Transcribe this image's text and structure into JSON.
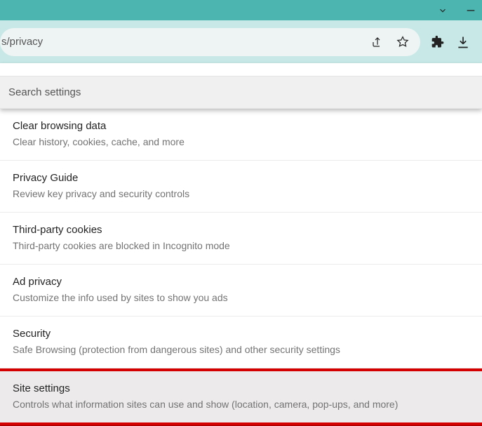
{
  "window": {
    "titlebar": {
      "caret_icon": "caret-down-icon",
      "minimize_icon": "minimize-icon"
    },
    "toolbar": {
      "url_fragment": "s/privacy",
      "share_icon": "share-icon",
      "star_icon": "star-icon",
      "puzzle_icon": "extensions-icon",
      "download_icon": "download-icon"
    }
  },
  "search": {
    "placeholder": "Search settings"
  },
  "items": [
    {
      "title": "Clear browsing data",
      "desc": "Clear history, cookies, cache, and more"
    },
    {
      "title": "Privacy Guide",
      "desc": "Review key privacy and security controls"
    },
    {
      "title": "Third-party cookies",
      "desc": "Third-party cookies are blocked in Incognito mode"
    },
    {
      "title": "Ad privacy",
      "desc": "Customize the info used by sites to show you ads"
    },
    {
      "title": "Security",
      "desc": "Safe Browsing (protection from dangerous sites) and other security settings"
    },
    {
      "title": "Site settings",
      "desc": "Controls what information sites can use and show (location, camera, pop-ups, and more)"
    }
  ]
}
